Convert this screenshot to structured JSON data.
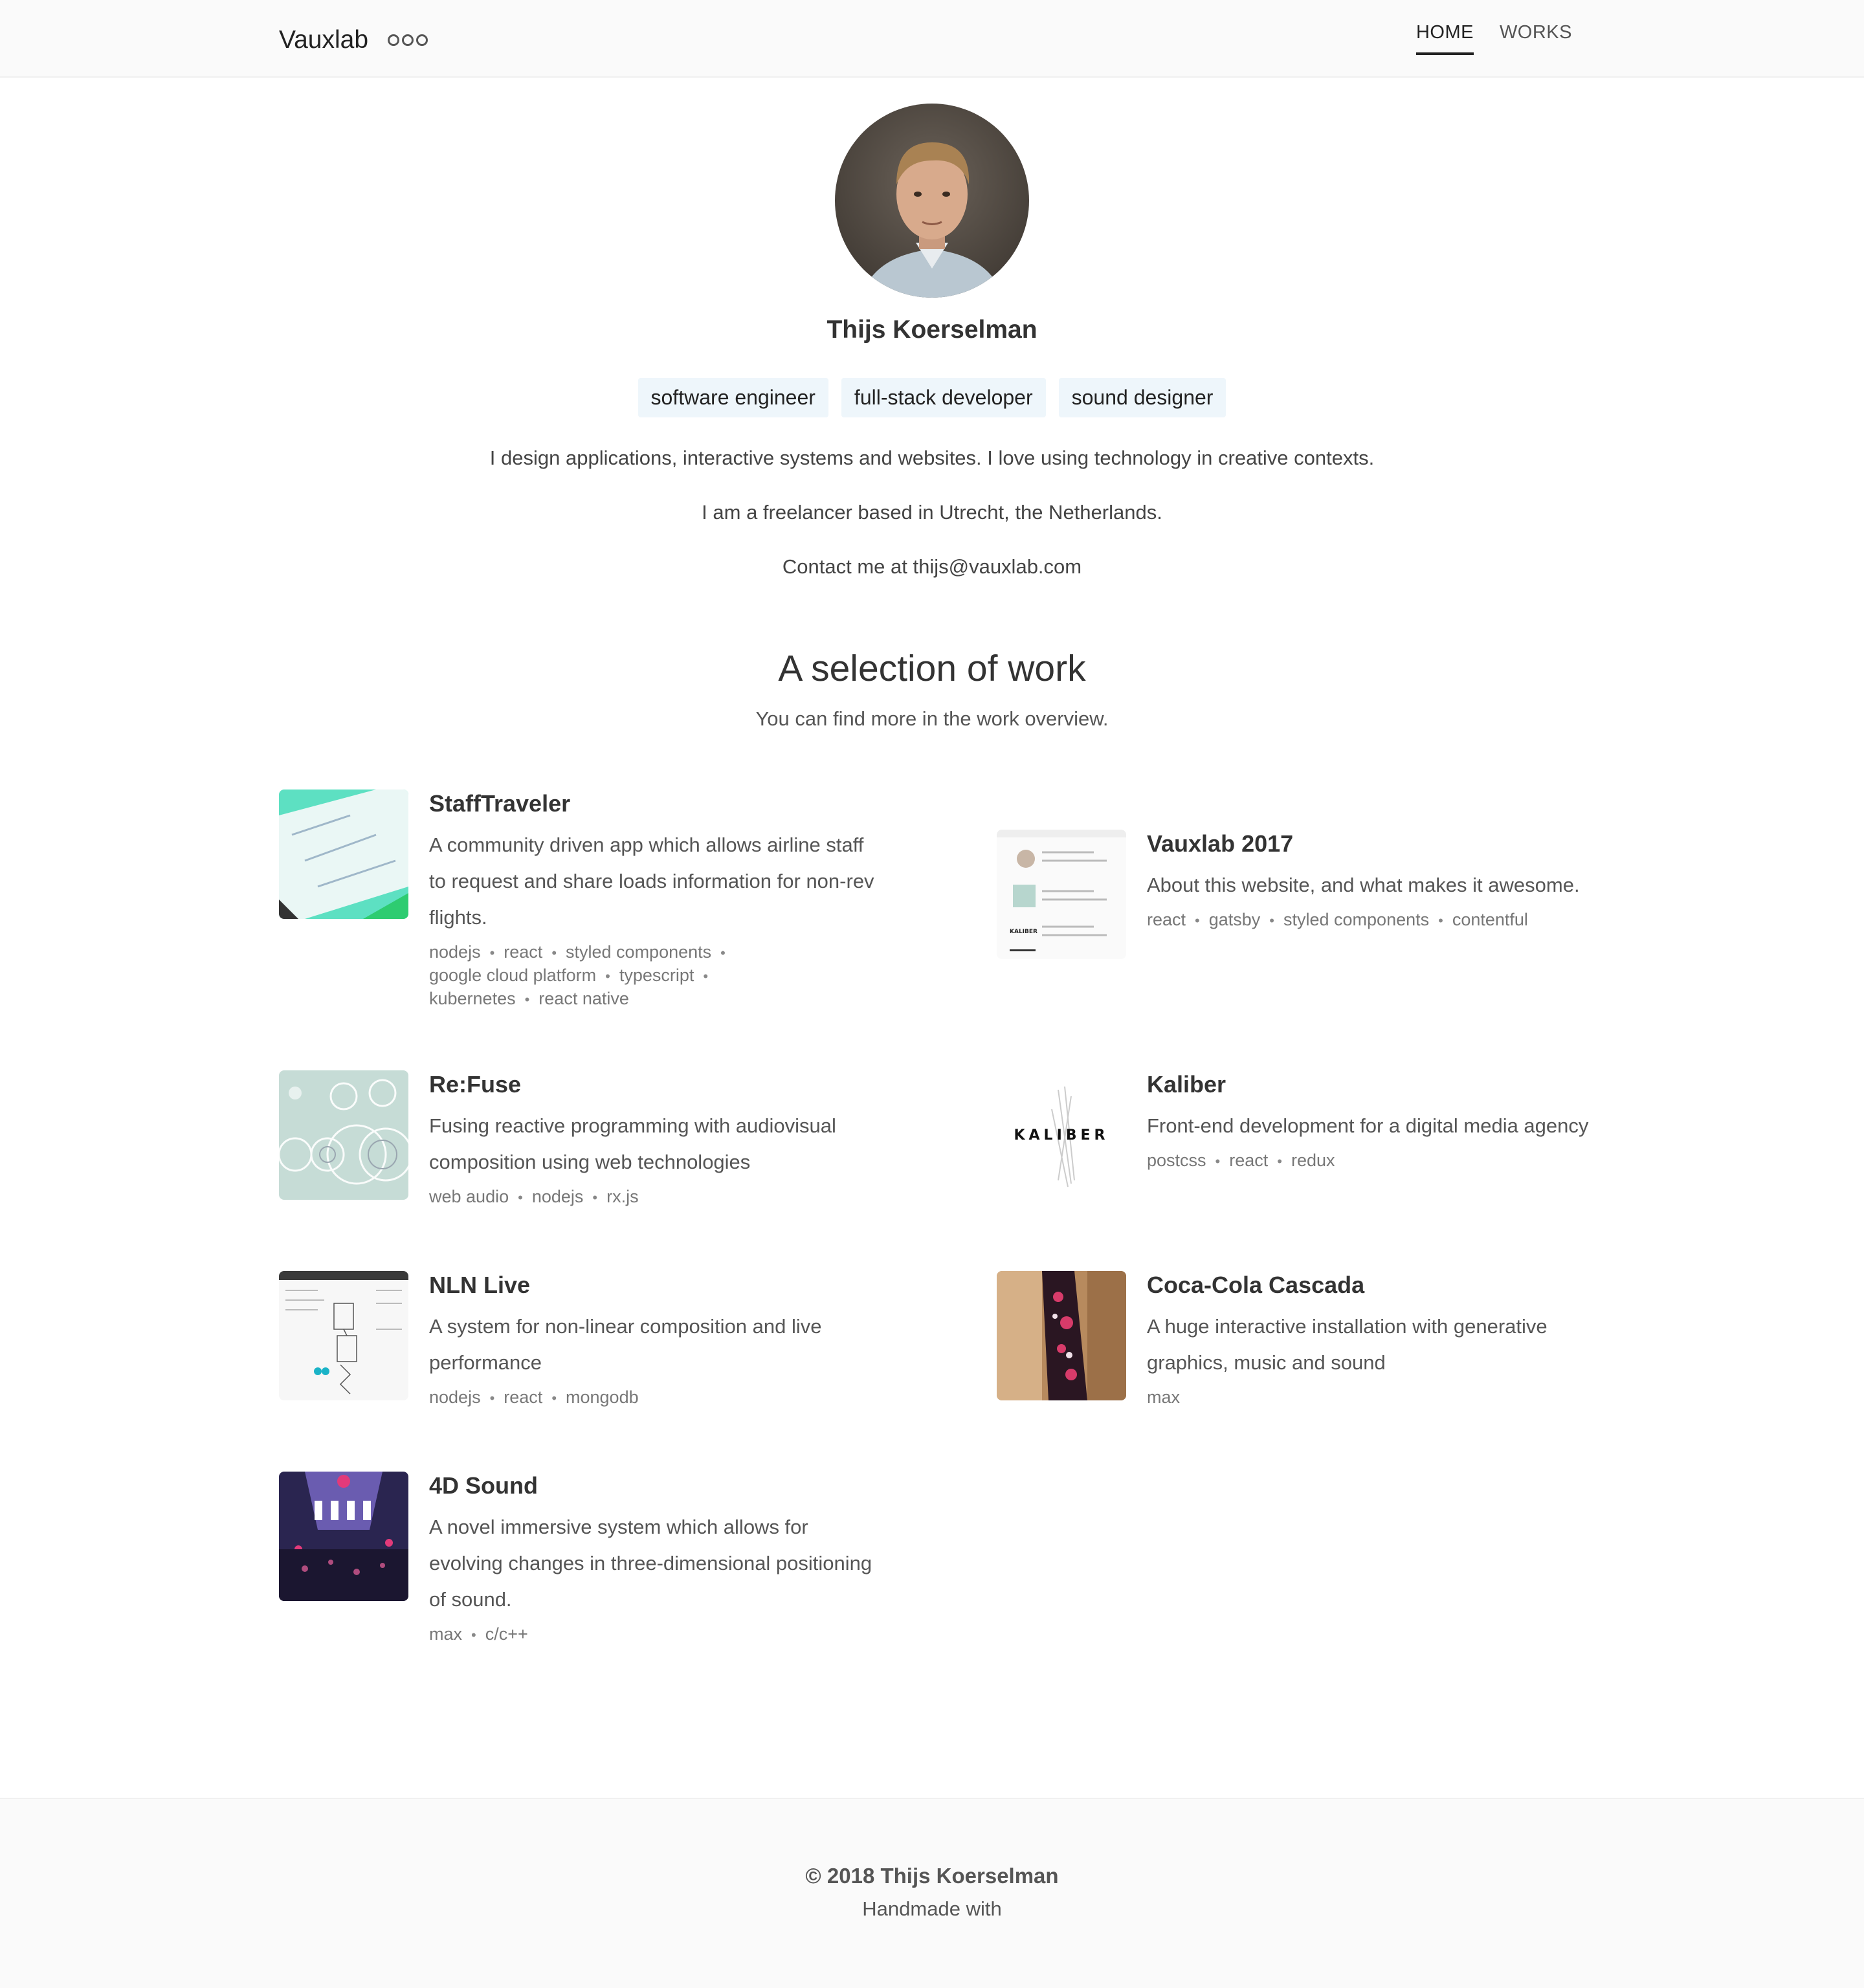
{
  "header": {
    "brand": "Vauxlab",
    "nav": [
      {
        "label": "HOME",
        "active": true
      },
      {
        "label": "WORKS",
        "active": false
      }
    ]
  },
  "profile": {
    "name": "Thijs Koerselman",
    "roles": [
      "software engineer",
      "full-stack developer",
      "sound designer"
    ],
    "intro": [
      "I design applications, interactive systems and websites. I love using technology in creative contexts.",
      "I am a freelancer based in Utrecht, the Netherlands.",
      "Contact me at thijs@vauxlab.com"
    ]
  },
  "works_section": {
    "title": "A selection of work",
    "subtitle": "You can find more in the work overview."
  },
  "works": [
    {
      "title": "StaffTraveler",
      "description": "A community driven app which allows airline staff to request and share loads information for non-rev flights.",
      "tags": [
        "nodejs",
        "react",
        "styled components",
        "google cloud platform",
        "typescript",
        "kubernetes",
        "react native"
      ]
    },
    {
      "title": "Vauxlab 2017",
      "description": "About this website, and what makes it awesome.",
      "tags": [
        "react",
        "gatsby",
        "styled components",
        "contentful"
      ],
      "thumb_text": "KALIBER"
    },
    {
      "title": "Re:Fuse",
      "description": "Fusing reactive programming with audiovisual composition using web technologies",
      "tags": [
        "web audio",
        "nodejs",
        "rx.js"
      ]
    },
    {
      "title": "Kaliber",
      "description": "Front-end development for a digital media agency",
      "tags": [
        "postcss",
        "react",
        "redux"
      ],
      "thumb_text": "KALIBER"
    },
    {
      "title": "NLN Live",
      "description": "A system for non-linear composition and live performance",
      "tags": [
        "nodejs",
        "react",
        "mongodb"
      ]
    },
    {
      "title": "Coca-Cola Cascada",
      "description": "A huge interactive installation with generative graphics, music and sound",
      "tags": [
        "max"
      ]
    },
    {
      "title": "4D Sound",
      "description": "A novel immersive system which allows for evolving changes in three-dimensional positioning of sound.",
      "tags": [
        "max",
        "c/c++"
      ]
    }
  ],
  "footer": {
    "copyright": "© 2018 Thijs Koerselman",
    "handmade": "Handmade with"
  },
  "colors": {
    "tag_background": "#eef6fb",
    "page_background": "#ffffff",
    "bar_background": "#fafafa"
  }
}
